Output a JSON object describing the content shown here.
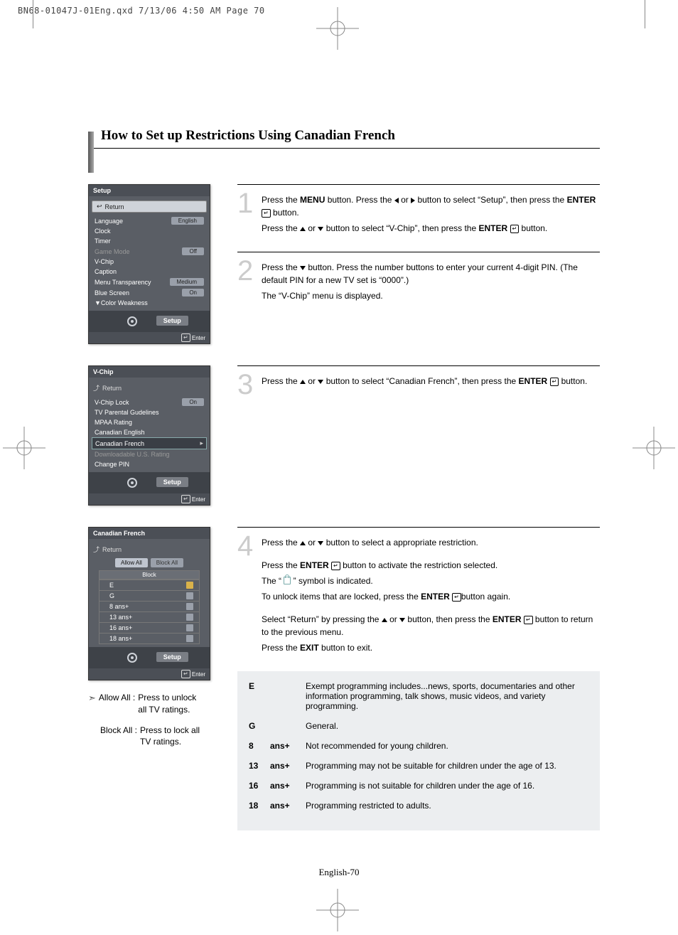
{
  "print_header": "BN68-01047J-01Eng.qxd  7/13/06  4:50 AM  Page 70",
  "section_title": "How to Set up Restrictions Using Canadian French",
  "page_number": "English-70",
  "osd1": {
    "title": "Setup",
    "return": "Return",
    "rows": [
      {
        "label": "Language",
        "value": "English"
      },
      {
        "label": "Clock",
        "value": ""
      },
      {
        "label": "Timer",
        "value": ""
      },
      {
        "label": "Game Mode",
        "value": "Off",
        "dim": true
      },
      {
        "label": "V-Chip",
        "value": ""
      },
      {
        "label": "Caption",
        "value": ""
      },
      {
        "label": "Menu Transparency",
        "value": "Medium"
      },
      {
        "label": "Blue Screen",
        "value": "On"
      },
      {
        "label": "▼Color Weakness",
        "value": ""
      }
    ],
    "footer_label": "Setup",
    "enter": "Enter"
  },
  "osd2": {
    "title": "V-Chip",
    "return": "Return",
    "rows": [
      {
        "label": "V-Chip Lock",
        "value": "On"
      },
      {
        "label": "TV Parental Gudelines",
        "value": ""
      },
      {
        "label": "MPAA Rating",
        "value": ""
      },
      {
        "label": "Canadian English",
        "value": ""
      },
      {
        "label": "Canadian French",
        "value": "",
        "sel": true,
        "arrow": true
      },
      {
        "label": "Downloadable U.S. Rating",
        "value": "",
        "dim": true
      },
      {
        "label": "Change PIN",
        "value": ""
      }
    ],
    "footer_label": "Setup",
    "enter": "Enter"
  },
  "osd3": {
    "title": "Canadian French",
    "return": "Return",
    "allow_all": "Allow All",
    "block_all": "Block All",
    "block_header": "Block",
    "ratings": [
      {
        "label": "E",
        "open": true
      },
      {
        "label": "G",
        "open": false
      },
      {
        "label": "8 ans+",
        "open": false
      },
      {
        "label": "13 ans+",
        "open": false
      },
      {
        "label": "16 ans+",
        "open": false
      },
      {
        "label": "18 ans+",
        "open": false
      }
    ],
    "footer_label": "Setup",
    "enter": "Enter"
  },
  "notes": {
    "allow_label": "Allow All :",
    "allow_text": "Press to unlock all TV ratings.",
    "block_label": "Block All :",
    "block_text": "Press to lock all TV ratings."
  },
  "steps": {
    "s1": {
      "num": "1",
      "l1a": "Press the ",
      "l1b": "MENU",
      "l1c": " button. Press the ",
      "l1d": " or ",
      "l1e": " button to select “Setup”, then press  the ",
      "l1f": "ENTER",
      "l1g": " button.",
      "l2a": "Press the ",
      "l2b": " or ",
      "l2c": " button to select “V-Chip”, then press the ",
      "l2d": "ENTER",
      "l2e": " button."
    },
    "s2": {
      "num": "2",
      "l1a": "Press the ",
      "l1b": " button. Press the number buttons to enter your current 4-digit PIN. (The default PIN for a new TV set is “0000”.)",
      "l2": "The “V-Chip” menu is displayed."
    },
    "s3": {
      "num": "3",
      "l1a": "Press the ",
      "l1b": " or ",
      "l1c": " button to select “Canadian  French”, then press the ",
      "l1d": "ENTER",
      "l1e": " button."
    },
    "s4": {
      "num": "4",
      "l1a": "Press the ",
      "l1b": " or ",
      "l1c": " button to select a appropriate restriction.",
      "l2a": "Press the ",
      "l2b": "ENTER",
      "l2c": " button to activate the restriction selected.",
      "l3a": "The “ ",
      "l3b": " ” symbol is indicated.",
      "l4a": "To unlock items that are locked, press the ",
      "l4b": "ENTER",
      "l4c": "button again.",
      "l5a": "Select “Return” by pressing the ",
      "l5b": " or ",
      "l5c": " button, then press the ",
      "l5d": "ENTER",
      "l5e": " button to return to the previous menu.",
      "l6a": "Press the ",
      "l6b": "EXIT",
      "l6c": " button to exit."
    }
  },
  "ratings_table": [
    {
      "code": "E",
      "suffix": "",
      "desc": "Exempt programming includes...news, sports, documentaries and other information programming, talk shows, music videos, and variety programming."
    },
    {
      "code": "G",
      "suffix": "",
      "desc": "General."
    },
    {
      "code": "8",
      "suffix": "ans+",
      "desc": "Not recommended for young children."
    },
    {
      "code": "13",
      "suffix": "ans+",
      "desc": "Programming may not be suitable for children under the age of 13."
    },
    {
      "code": "16",
      "suffix": "ans+",
      "desc": "Programming is not suitable for children under the age of 16."
    },
    {
      "code": "18",
      "suffix": "ans+",
      "desc": "Programming restricted to adults."
    }
  ]
}
